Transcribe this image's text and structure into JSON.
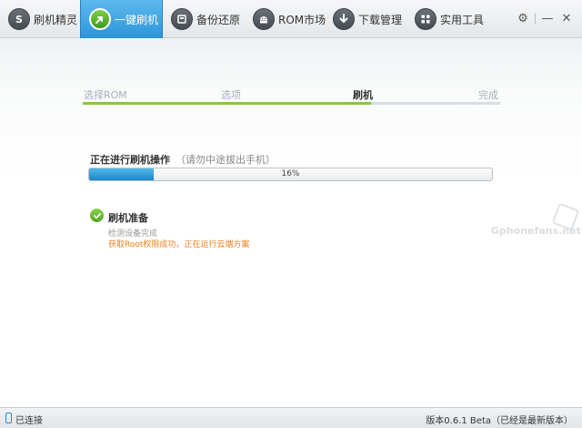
{
  "toolbar": {
    "tabs": [
      {
        "label": "刷机精灵",
        "icon": "s-logo-icon",
        "active": false
      },
      {
        "label": "一键刷机",
        "icon": "flash-arrow-icon",
        "active": true
      },
      {
        "label": "备份还原",
        "icon": "backup-icon",
        "active": false
      },
      {
        "label": "ROM市场",
        "icon": "android-icon",
        "active": false
      },
      {
        "label": "下载管理",
        "icon": "download-icon",
        "active": false
      },
      {
        "label": "实用工具",
        "icon": "tools-grid-icon",
        "active": false
      }
    ],
    "window_buttons": {
      "settings": "⚙",
      "minimize": "—",
      "close": "✕"
    }
  },
  "steps": {
    "items": [
      "选择ROM",
      "选项",
      "刷机",
      "完成"
    ],
    "current_index": 2,
    "progress_fraction": 0.69
  },
  "operation": {
    "title": "正在进行刷机操作",
    "hint": "（请勿中途拔出手机）",
    "progress_value": 16,
    "progress_text": "16%"
  },
  "stage": {
    "title": "刷机准备",
    "line1": "检测设备完成",
    "line2": "获取Root权限成功，正在运行云端方案"
  },
  "watermark": "Gphonefans.net",
  "statusbar": {
    "connection": "已连接",
    "version": "版本0.6.1 Beta（已经是最新版本）"
  },
  "colors": {
    "accent_blue": "#2c95d8",
    "step_green": "#8cc63f",
    "warning_orange": "#f07d1b"
  }
}
